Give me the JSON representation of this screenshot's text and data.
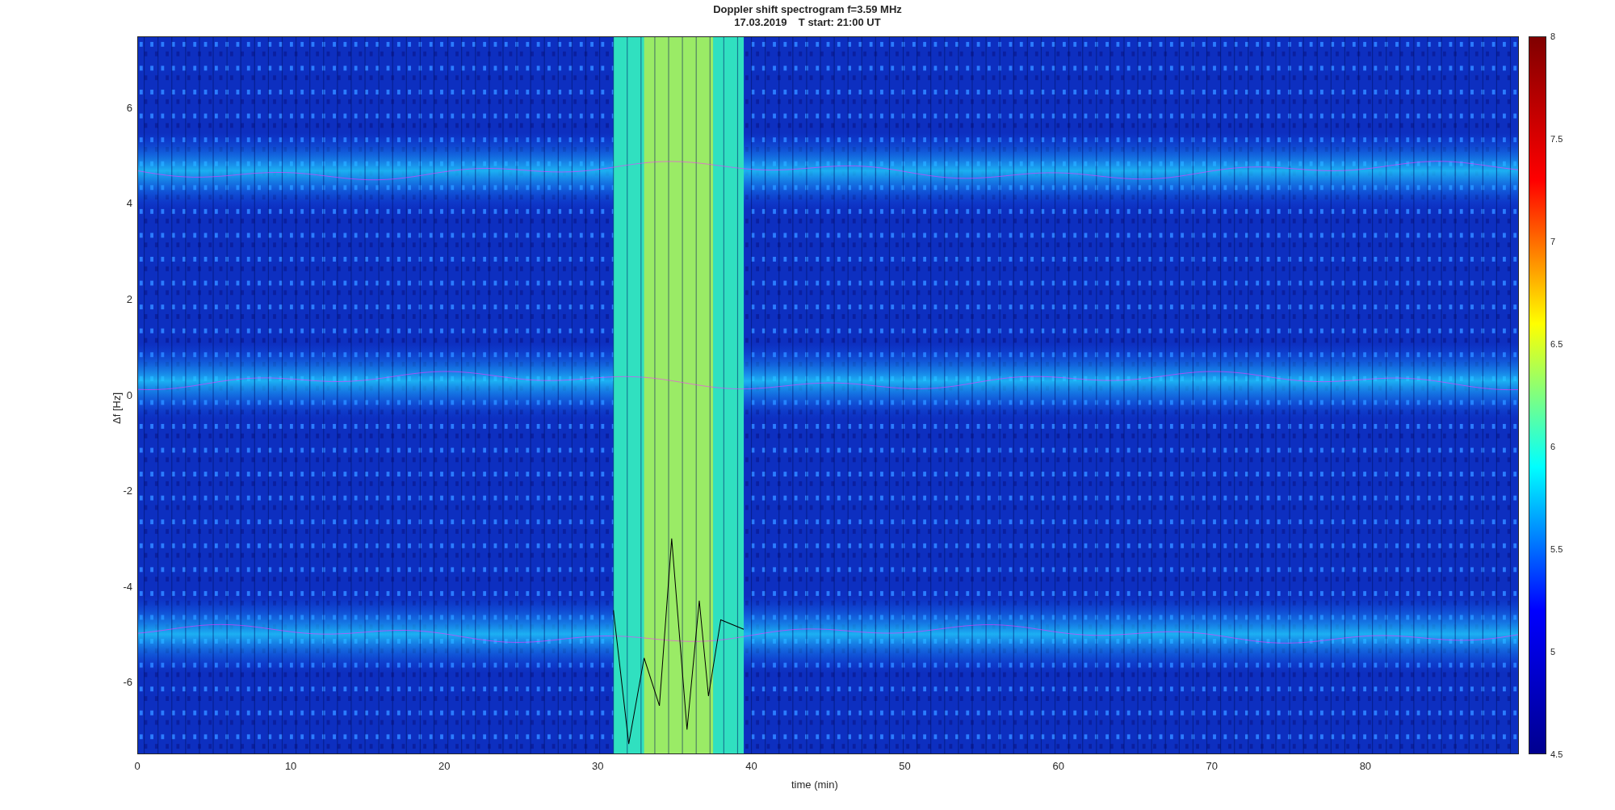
{
  "title": {
    "line_1": "Doppler shift spectrogram f=3.59 MHz",
    "line_2": "17.03.2019    T start: 21:00 UT"
  },
  "axes": {
    "xlabel": "time (min)",
    "ylabel": "Δf [Hz]",
    "xticks": [
      "0",
      "10",
      "20",
      "30",
      "40",
      "50",
      "60",
      "70",
      "80"
    ],
    "yticks": [
      "6",
      "4",
      "2",
      "0",
      "-2",
      "-4",
      "-6"
    ]
  },
  "colorbar": {
    "ticks": [
      "8",
      "7.5",
      "7",
      "6.5",
      "6",
      "5.5",
      "5",
      "4.5"
    ]
  }
}
